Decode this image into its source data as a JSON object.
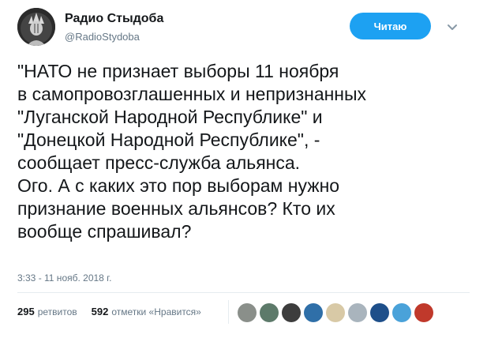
{
  "author": {
    "display_name": "Радио Стыдоба",
    "handle": "@RadioStydoba",
    "avatar_icon": "statue-of-liberty-avatar-icon"
  },
  "follow_button": {
    "label": "Читаю"
  },
  "menu_icon": "chevron-down-icon",
  "tweet": {
    "text": "\"НАТО не признает выборы 11 ноября\nв самопровозглашенных и непризнанных\n\"Луганской Народной Республике\" и\n\"Донецкой Народной Республике\", -\nсообщает пресс-служба альянса.\nОго. А с каких это пор выборам нужно\nпризнание военных альянсов? Кто их\nвообще спрашивал?",
    "timestamp": "3:33 - 11 нояб. 2018 г."
  },
  "stats": {
    "retweets_count": "295",
    "retweets_label": "ретвитов",
    "likes_count": "592",
    "likes_label": "отметки «Нравится»"
  },
  "likers": [
    {
      "name": "liker-avatar-1",
      "color": "#8a8f8a"
    },
    {
      "name": "liker-avatar-2",
      "color": "#5d7a6a"
    },
    {
      "name": "liker-avatar-3",
      "color": "#3d3d3d"
    },
    {
      "name": "liker-avatar-4",
      "color": "#2f6fa8"
    },
    {
      "name": "liker-avatar-5",
      "color": "#d8c9a6"
    },
    {
      "name": "liker-avatar-6",
      "color": "#a9b4bd"
    },
    {
      "name": "liker-avatar-7",
      "color": "#1e4f8a"
    },
    {
      "name": "liker-avatar-8",
      "color": "#4aa2d9"
    },
    {
      "name": "liker-avatar-9",
      "color": "#c0392b"
    }
  ],
  "colors": {
    "accent": "#1da1f2",
    "text": "#14171a",
    "secondary_text": "#657786"
  }
}
